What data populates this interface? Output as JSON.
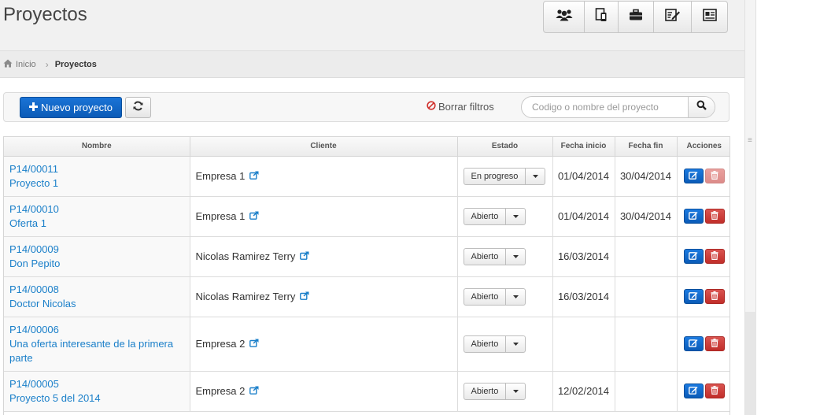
{
  "page": {
    "title": "Proyectos"
  },
  "toolbar": {
    "buttons": [
      {
        "icon": "users-icon"
      },
      {
        "icon": "mobile-document-icon"
      },
      {
        "icon": "briefcase-icon"
      },
      {
        "icon": "edit-document-icon"
      },
      {
        "icon": "id-card-icon"
      }
    ]
  },
  "breadcrumb": {
    "home_label": "Inicio",
    "current_label": "Proyectos"
  },
  "actions": {
    "new_project_label": "Nuevo proyecto",
    "clear_filters_label": "Borrar filtros",
    "search_placeholder": "Codigo o nombre del proyecto"
  },
  "table": {
    "headers": [
      "Nombre",
      "Cliente",
      "Estado",
      "Fecha inicio",
      "Fecha fin",
      "Acciones"
    ],
    "rows": [
      {
        "code": "P14/00011",
        "name": "Proyecto 1",
        "client": "Empresa 1",
        "status": "En progreso",
        "start": "01/04/2014",
        "end": "30/04/2014",
        "delete_disabled": true
      },
      {
        "code": "P14/00010",
        "name": "Oferta 1",
        "client": "Empresa 1",
        "status": "Abierto",
        "start": "01/04/2014",
        "end": "30/04/2014",
        "delete_disabled": false
      },
      {
        "code": "P14/00009",
        "name": "Don Pepito",
        "client": "Nicolas Ramirez Terry",
        "status": "Abierto",
        "start": "16/03/2014",
        "end": "",
        "delete_disabled": false
      },
      {
        "code": "P14/00008",
        "name": "Doctor Nicolas",
        "client": "Nicolas Ramirez Terry",
        "status": "Abierto",
        "start": "16/03/2014",
        "end": "",
        "delete_disabled": false
      },
      {
        "code": "P14/00006",
        "name": "Una oferta interesante de la primera parte",
        "client": "Empresa 2",
        "status": "Abierto",
        "start": "",
        "end": "",
        "delete_disabled": false
      },
      {
        "code": "P14/00005",
        "name": "Proyecto 5 del 2014",
        "client": "Empresa 2",
        "status": "Abierto",
        "start": "12/02/2014",
        "end": "",
        "delete_disabled": false
      }
    ]
  },
  "colors": {
    "primary": "#0b5bb7",
    "danger": "#c12e2a",
    "link": "#1a7fc9",
    "danger_text": "#d0312d"
  }
}
